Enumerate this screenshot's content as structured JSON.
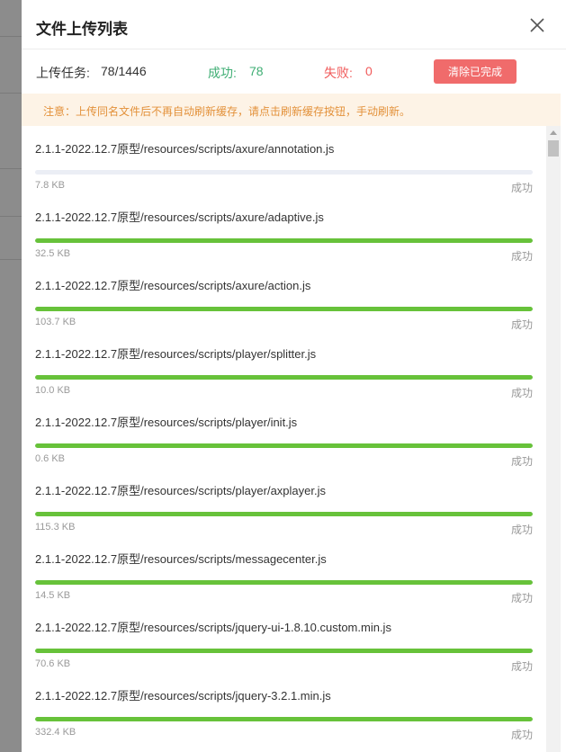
{
  "dialog": {
    "title": "文件上传列表",
    "close_icon": "close-icon"
  },
  "stats": {
    "task_label": "上传任务:",
    "task_value": "78/1446",
    "success_label": "成功:",
    "success_value": "78",
    "fail_label": "失败:",
    "fail_value": "0",
    "clear_button": "清除已完成"
  },
  "colors": {
    "success": "#3fae74",
    "fail": "#f05a5a",
    "progress": "#67c23a",
    "notice_text": "#e3913a",
    "notice_bg": "#fdf3e6",
    "clear_button_bg": "#f06b6b"
  },
  "notice": {
    "text": "注意：上传同名文件后不再自动刷新缓存，请点击刷新缓存按钮，手动刷新。"
  },
  "files": [
    {
      "path": "2.1.1-2022.12.7原型/resources/scripts/axure/annotation.js",
      "size": "7.8 KB",
      "status": "成功",
      "progress": 0
    },
    {
      "path": "2.1.1-2022.12.7原型/resources/scripts/axure/adaptive.js",
      "size": "32.5 KB",
      "status": "成功",
      "progress": 100
    },
    {
      "path": "2.1.1-2022.12.7原型/resources/scripts/axure/action.js",
      "size": "103.7 KB",
      "status": "成功",
      "progress": 100
    },
    {
      "path": "2.1.1-2022.12.7原型/resources/scripts/player/splitter.js",
      "size": "10.0 KB",
      "status": "成功",
      "progress": 100
    },
    {
      "path": "2.1.1-2022.12.7原型/resources/scripts/player/init.js",
      "size": "0.6 KB",
      "status": "成功",
      "progress": 100
    },
    {
      "path": "2.1.1-2022.12.7原型/resources/scripts/player/axplayer.js",
      "size": "115.3 KB",
      "status": "成功",
      "progress": 100
    },
    {
      "path": "2.1.1-2022.12.7原型/resources/scripts/messagecenter.js",
      "size": "14.5 KB",
      "status": "成功",
      "progress": 100
    },
    {
      "path": "2.1.1-2022.12.7原型/resources/scripts/jquery-ui-1.8.10.custom.min.js",
      "size": "70.6 KB",
      "status": "成功",
      "progress": 100
    },
    {
      "path": "2.1.1-2022.12.7原型/resources/scripts/jquery-3.2.1.min.js",
      "size": "332.4 KB",
      "status": "成功",
      "progress": 100
    }
  ]
}
